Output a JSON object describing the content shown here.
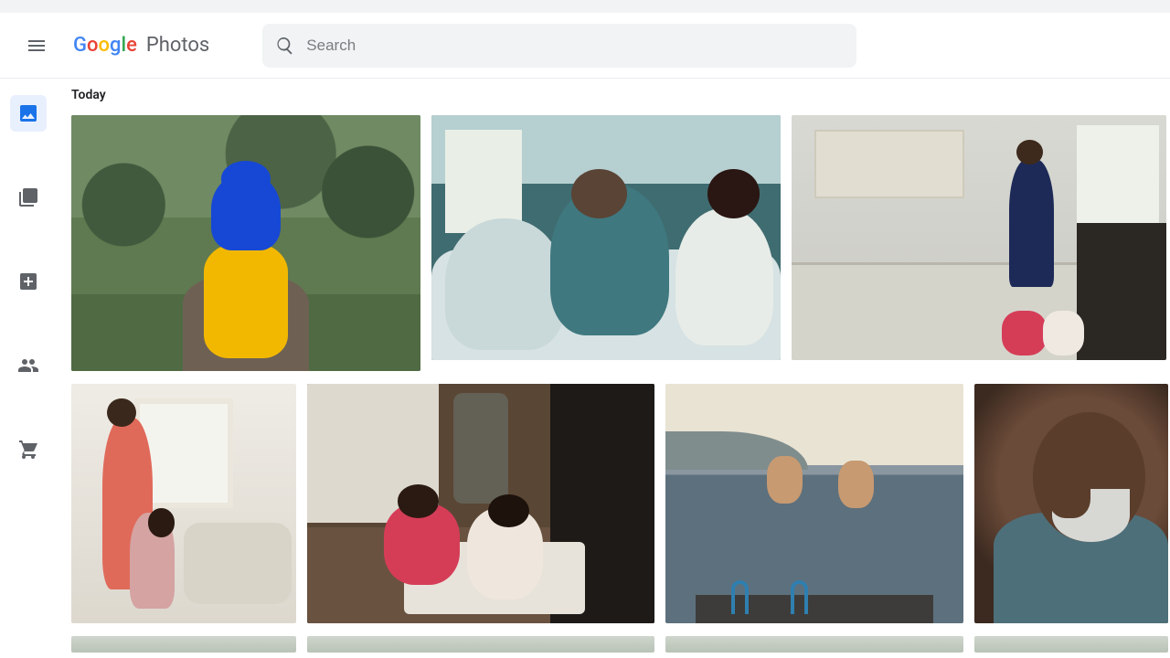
{
  "brand": {
    "google_letters": [
      {
        "c": "G",
        "color": "#4285F4"
      },
      {
        "c": "o",
        "color": "#EA4335"
      },
      {
        "c": "o",
        "color": "#FBBC05"
      },
      {
        "c": "g",
        "color": "#4285F4"
      },
      {
        "c": "l",
        "color": "#34A853"
      },
      {
        "c": "e",
        "color": "#EA4335"
      }
    ],
    "product": "Photos"
  },
  "search": {
    "placeholder": "Search",
    "value": ""
  },
  "sidenav": {
    "items": [
      {
        "name": "photos",
        "active": true
      },
      {
        "name": "albums",
        "active": false
      },
      {
        "name": "archive",
        "active": false
      },
      {
        "name": "sharing",
        "active": false
      },
      {
        "name": "store",
        "active": false
      }
    ]
  },
  "sections": [
    {
      "label": "Today"
    }
  ]
}
